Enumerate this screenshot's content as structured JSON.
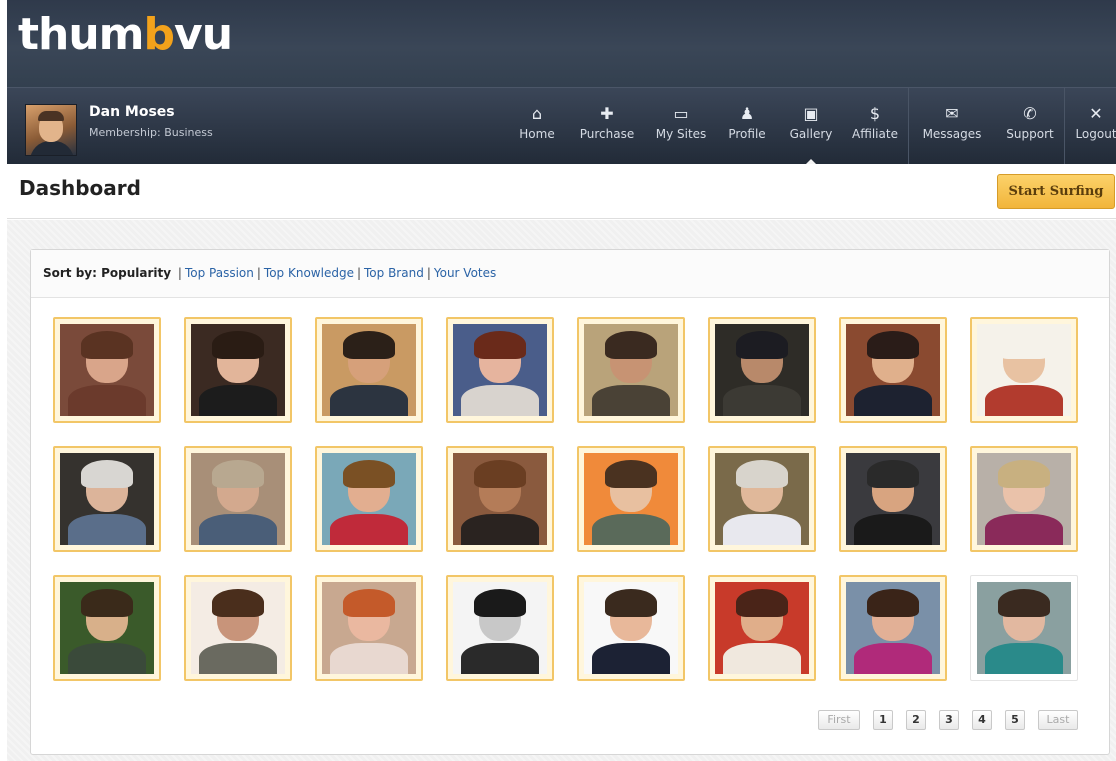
{
  "brand": {
    "logo_part1": "thum",
    "logo_accent": "b",
    "logo_part2": "vu",
    "accent_color": "#f3a21b"
  },
  "user": {
    "name": "Dan Moses",
    "membership": "Membership: Business"
  },
  "nav": {
    "items": [
      {
        "label": "Home",
        "icon": "home-icon",
        "glyph": "⌂"
      },
      {
        "label": "Purchase",
        "icon": "plus-icon",
        "glyph": "✚"
      },
      {
        "label": "My Sites",
        "icon": "monitor-icon",
        "glyph": "▭"
      },
      {
        "label": "Profile",
        "icon": "person-icon",
        "glyph": "♟"
      },
      {
        "label": "Gallery",
        "icon": "image-icon",
        "glyph": "▣",
        "active": true
      },
      {
        "label": "Affiliate",
        "icon": "dollar-icon",
        "glyph": "$"
      },
      {
        "label": "Messages",
        "icon": "envelope-icon",
        "glyph": "✉"
      },
      {
        "label": "Support",
        "icon": "phone-icon",
        "glyph": "✆"
      },
      {
        "label": "Logout",
        "icon": "close-icon",
        "glyph": "✕"
      }
    ]
  },
  "header": {
    "title": "Dashboard",
    "start_button": "Start Surfing"
  },
  "sort": {
    "label": "Sort by: Popularity",
    "links": [
      "Top Passion",
      "Top Knowledge",
      "Top Brand",
      "Your Votes"
    ]
  },
  "gallery": {
    "rows": 3,
    "columns": 8,
    "thumbnails": [
      {
        "bg": "#7a4a3a",
        "face": "#d9a58a",
        "hair": "#5a3322",
        "torso": "#6b3a2c"
      },
      {
        "bg": "#3b2a22",
        "face": "#e2b59a",
        "hair": "#2a1c14",
        "torso": "#1c1c1c"
      },
      {
        "bg": "#c99a63",
        "face": "#d6a07a",
        "hair": "#2b2018",
        "torso": "#2c3440"
      },
      {
        "bg": "#4a5d8a",
        "face": "#e6b49e",
        "hair": "#6a2a1a",
        "torso": "#d8d3ce"
      },
      {
        "bg": "#b9a37a",
        "face": "#c79373",
        "hair": "#3a2a20",
        "torso": "#4a4236"
      },
      {
        "bg": "#2e2c27",
        "face": "#b8896a",
        "hair": "#1c1c22",
        "torso": "#3c3a34"
      },
      {
        "bg": "#8a4a30",
        "face": "#e0b08c",
        "hair": "#2a1c18",
        "torso": "#1d2230"
      },
      {
        "bg": "#f5f2ea",
        "face": "#e8c2a2",
        "hair": "#f5f2ea",
        "torso": "#b23b2e"
      },
      {
        "bg": "#35322e",
        "face": "#dcb49a",
        "hair": "#d8d6d2",
        "torso": "#5a6e8a"
      },
      {
        "bg": "#a88f78",
        "face": "#d3a98e",
        "hair": "#b8a890",
        "torso": "#4a5e78"
      },
      {
        "bg": "#7aa8b8",
        "face": "#e2ae90",
        "hair": "#7a5024",
        "torso": "#c02a3a"
      },
      {
        "bg": "#8a5a3e",
        "face": "#b47c58",
        "hair": "#6a3e22",
        "torso": "#2a2320"
      },
      {
        "bg": "#f08a3a",
        "face": "#e8c0a0",
        "hair": "#4a3220",
        "torso": "#5a6a5a"
      },
      {
        "bg": "#7a6a4a",
        "face": "#e0b89a",
        "hair": "#d8d4cc",
        "torso": "#e8e8ee"
      },
      {
        "bg": "#3a3a3e",
        "face": "#d8a480",
        "hair": "#2a2a2a",
        "torso": "#1a1a1a"
      },
      {
        "bg": "#b8b0a8",
        "face": "#eac2aa",
        "hair": "#c8b080",
        "torso": "#8a2a5a"
      },
      {
        "bg": "#3a5a2a",
        "face": "#d8b08a",
        "hair": "#3a2a1a",
        "torso": "#3a4a3a"
      },
      {
        "bg": "#f4ece4",
        "face": "#c8947a",
        "hair": "#4a2e1c",
        "torso": "#6a6a60"
      },
      {
        "bg": "#c8a890",
        "face": "#eab8a0",
        "hair": "#c45a2a",
        "torso": "#e8d8d0"
      },
      {
        "bg": "#f4f4f4",
        "face": "#c8c8c8",
        "hair": "#1a1a1a",
        "torso": "#2a2a2a"
      },
      {
        "bg": "#f8f8f8",
        "face": "#e8b89a",
        "hair": "#3a2a1e",
        "torso": "#1c2234"
      },
      {
        "bg": "#c83a2a",
        "face": "#e0ae8a",
        "hair": "#4a2418",
        "torso": "#f0e8de"
      },
      {
        "bg": "#7a90a8",
        "face": "#e2b096",
        "hair": "#3a2418",
        "torso": "#b02a7a"
      },
      {
        "bg": "#8aa0a0",
        "face": "#e2b8a0",
        "hair": "#3a2a20",
        "torso": "#2a8a8a"
      }
    ]
  },
  "pagination": {
    "first": "First",
    "pages": [
      "1",
      "2",
      "3",
      "4",
      "5"
    ],
    "last": "Last"
  }
}
